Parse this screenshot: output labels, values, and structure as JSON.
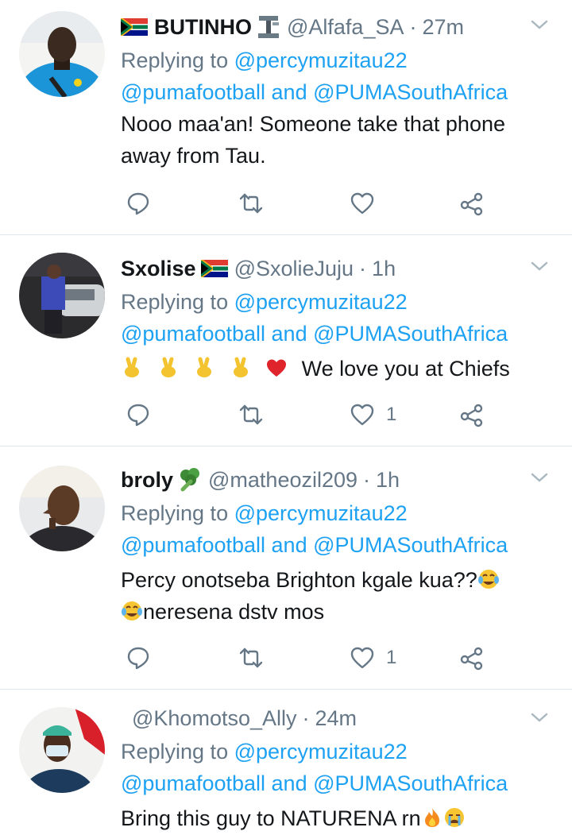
{
  "tweets": [
    {
      "display_name": "BUTINHO",
      "handle": "@Alfafa_SA",
      "time": "27m",
      "replying_prefix": "Replying to",
      "reply_to": "@percymuzitau22",
      "reply_also_1": "@pumafootball",
      "reply_and": "and",
      "reply_also_2": "@PUMASouthAfrica",
      "text_line1": "Nooo maa'an! Someone take that phone",
      "text_line2": "away from Tau.",
      "likes": ""
    },
    {
      "display_name": "Sxolise",
      "handle": "@SxolieJuju",
      "time": "1h",
      "replying_prefix": "Replying to",
      "reply_to": "@percymuzitau22",
      "reply_also_1": "@pumafootball",
      "reply_and": "and",
      "reply_also_2": "@PUMASouthAfrica",
      "text_line1": "We love you at Chiefs",
      "likes": "1"
    },
    {
      "display_name": "broly",
      "handle": "@matheozil209",
      "time": "1h",
      "replying_prefix": "Replying to",
      "reply_to": "@percymuzitau22",
      "reply_also_1": "@pumafootball",
      "reply_and": "and",
      "reply_also_2": "@PUMASouthAfrica",
      "text_line1": "Percy onotseba Brighton kgale kua??",
      "text_line2": "neresena dstv mos",
      "likes": "1"
    },
    {
      "display_name": "",
      "handle": "@Khomotso_Ally",
      "time": "24m",
      "replying_prefix": "Replying to",
      "reply_to": "@percymuzitau22",
      "reply_also_1": "@pumafootball",
      "reply_and": "and",
      "reply_also_2": "@PUMASouthAfrica",
      "text_line1": "Bring this guy to NATURENA rn"
    }
  ],
  "icons": {
    "reply": "reply-icon",
    "retweet": "retweet-icon",
    "like": "heart-icon",
    "share": "share-icon",
    "more": "chevron-down-icon"
  },
  "colors": {
    "link": "#1da1f2",
    "secondary_text": "#657786",
    "divider": "#e1e8ed"
  }
}
